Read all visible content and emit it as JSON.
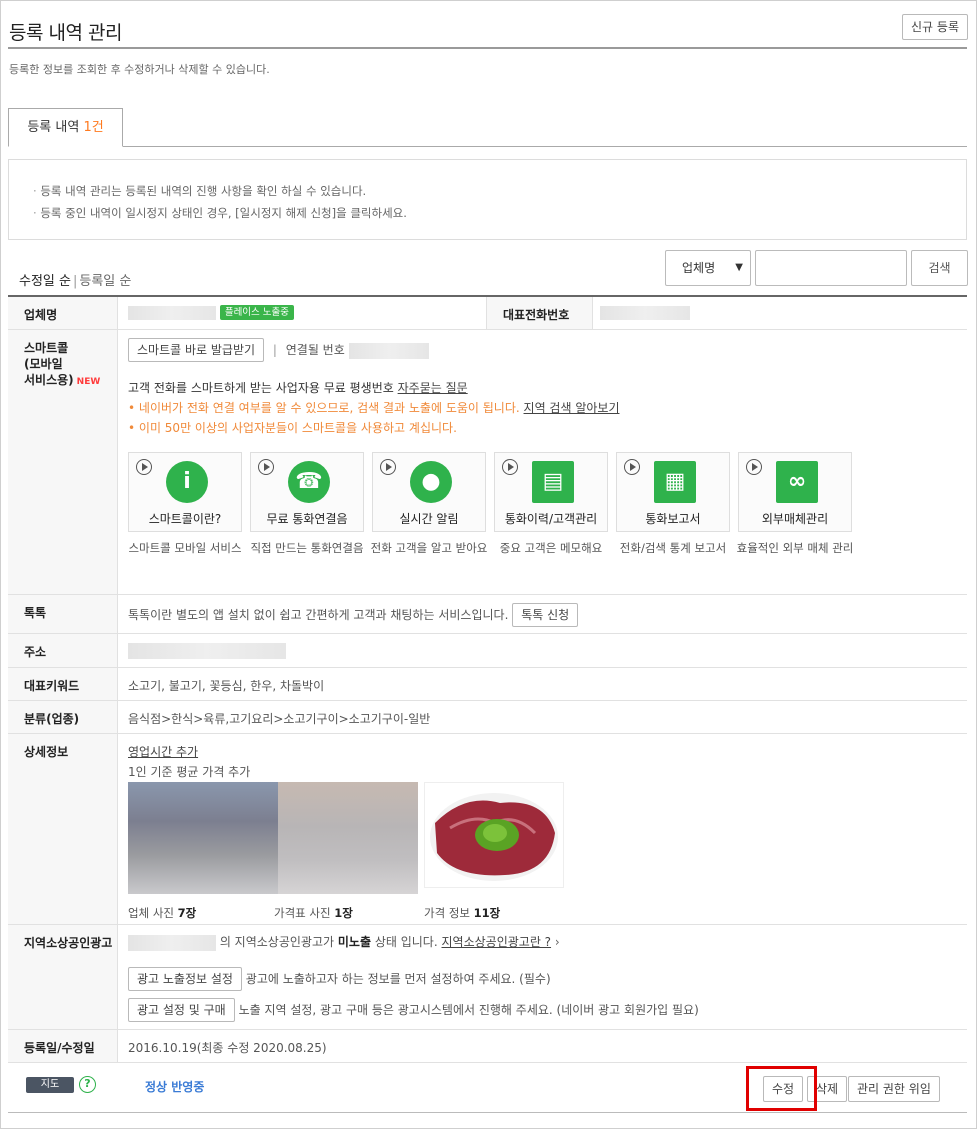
{
  "header": {
    "title": "등록 내역 관리",
    "new_button": "신규 등록",
    "description": "등록한 정보를 조회한 후 수정하거나 삭제할 수 있습니다."
  },
  "tab": {
    "label": "등록 내역",
    "count": "1건"
  },
  "notice": [
    "등록 내역 관리는 등록된 내역의 진행 사항을 확인 하실 수 있습니다.",
    "등록 중인 내역이 일시정지 상태인 경우, [일시정지 해제 신청]을 클릭하세요."
  ],
  "sort": {
    "active": "수정일 순",
    "other": "등록일 순"
  },
  "search": {
    "select_value": "업체명",
    "input_value": "",
    "button": "검색"
  },
  "rows": {
    "company": {
      "label": "업체명",
      "badge": "플레이스 노출중",
      "phone_label": "대표전화번호"
    },
    "smartcall": {
      "label": "스마트콜\n(모바일\n서비스용)",
      "new_tag": "NEW",
      "issue_button": "스마트콜 바로 발급받기",
      "linked_label": "연결될 번호",
      "intro": "고객 전화를 스마트하게 받는 사업자용 무료 평생번호",
      "faq_link": "자주묻는 질문",
      "bullet1": "네이버가 전화 연결 여부를 알 수 있으므로, 검색 결과 노출에 도움이 됩니다.",
      "bullet1_link": "지역 검색 알아보기",
      "bullet2": "이미 50만 이상의 사업자분들이 스마트콜을 사용하고 계십니다.",
      "services": [
        {
          "label": "스마트콜이란?",
          "caption": "스마트콜 모바일 서비스",
          "icon": "info-icon",
          "glyph": "i"
        },
        {
          "label": "무료 통화연결음",
          "caption": "직접 만드는 통화연결음",
          "icon": "phone-icon",
          "glyph": "☎"
        },
        {
          "label": "실시간 알림",
          "caption": "전화 고객을 알고 받아요",
          "icon": "user-icon",
          "glyph": "●"
        },
        {
          "label": "통화이력/고객관리",
          "caption": "중요 고객은 메모해요",
          "icon": "contact-card-icon",
          "glyph": "▤"
        },
        {
          "label": "통화보고서",
          "caption": "전화/검색 통계 보고서",
          "icon": "report-icon",
          "glyph": "▦"
        },
        {
          "label": "외부매체관리",
          "caption": "효율적인 외부 매체 관리",
          "icon": "link-icon",
          "glyph": "∞"
        }
      ]
    },
    "talktalk": {
      "label": "톡톡",
      "text": "톡톡이란 별도의 앱 설치 없이 쉽고 간편하게 고객과 채팅하는 서비스입니다.",
      "button": "톡톡 신청"
    },
    "address": {
      "label": "주소"
    },
    "keywords": {
      "label": "대표키워드",
      "value": "소고기, 불고기, 꽃등심, 한우, 차돌박이"
    },
    "category": {
      "label": "분류(업종)",
      "value": "음식점>한식>육류,고기요리>소고기구이>소고기구이-일반"
    },
    "detail": {
      "label": "상세정보",
      "hours_link": "영업시간 추가",
      "price_text": "1인 기준 평균 가격 추가",
      "photos": [
        {
          "label": "업체 사진",
          "count": "7장"
        },
        {
          "label": "가격표 사진",
          "count": "1장"
        },
        {
          "label": "가격 정보",
          "count": "11장"
        }
      ]
    },
    "local_ad": {
      "label": "지역소상공인광고",
      "status_prefix": "의 지역소상공인광고가",
      "status_value": "미노출",
      "status_suffix": "상태 입니다.",
      "help_link": "지역소상공인광고란 ?",
      "btn1": "광고 노출정보 설정",
      "btn1_desc": "광고에 노출하고자 하는 정보를 먼저 설정하여 주세요. (필수)",
      "btn2": "광고 설정 및 구매",
      "btn2_desc": "노출 지역 설정, 광고 구매 등은 광고시스템에서 진행해 주세요. (네이버 광고 회원가입 필요)"
    },
    "dates": {
      "label": "등록일/수정일",
      "value": "2016.10.19(최종 수정 2020.08.25)"
    }
  },
  "footer": {
    "map_button": "지도",
    "help": "?",
    "status": "정상 반영중",
    "edit": "수정",
    "delete": "삭제",
    "delegate": "관리 권한 위임"
  },
  "colors": {
    "accent_green": "#3ab54a",
    "accent_orange": "#f08a3a",
    "status_blue": "#3a7bd5",
    "highlight_red": "#e00000"
  }
}
